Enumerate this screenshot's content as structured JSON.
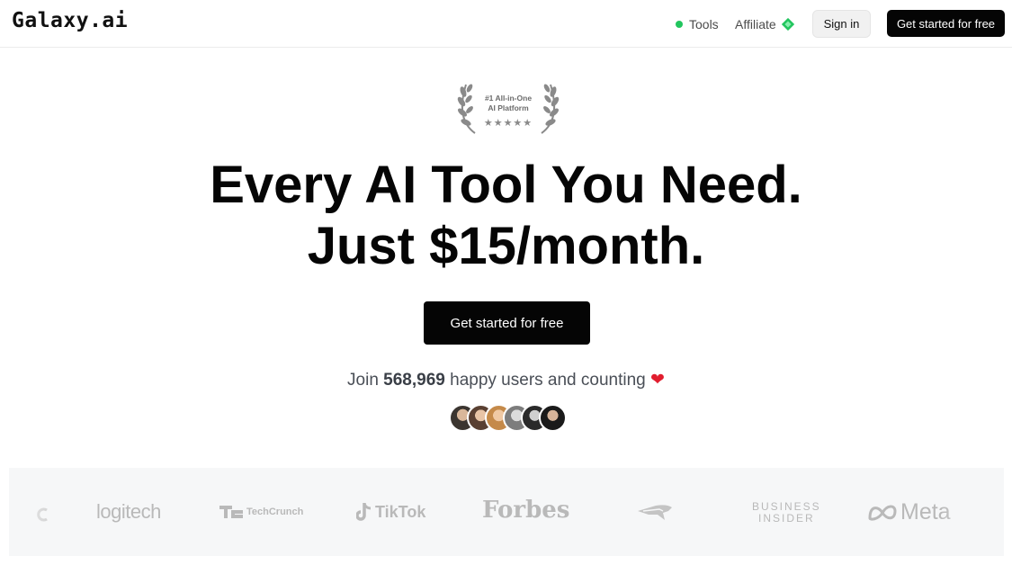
{
  "brand": {
    "name": "Galaxy.ai"
  },
  "nav": {
    "tools_label": "Tools",
    "affiliate_label": "Affiliate",
    "signin_label": "Sign in",
    "cta_label": "Get started for free"
  },
  "badge": {
    "line1": "#1 All-in-One",
    "line2": "AI Platform",
    "stars": "★★★★★",
    "rating": 5
  },
  "hero": {
    "headline_line1": "Every AI Tool You Need.",
    "headline_line2": "Just $15/month.",
    "cta_label": "Get started for free"
  },
  "social_proof": {
    "prefix": "Join",
    "count": "568,969",
    "suffix": "happy users and counting",
    "heart": "❤"
  },
  "logos": {
    "items": [
      "logitech",
      "TechCrunch",
      "TikTok",
      "Forbes",
      "BUSINESS",
      "INSIDER",
      "Meta"
    ]
  },
  "colors": {
    "accent": "#050505",
    "status_dot": "#22c55e",
    "heart": "#e11d2e",
    "logo_gray": "#b9b9b9"
  }
}
